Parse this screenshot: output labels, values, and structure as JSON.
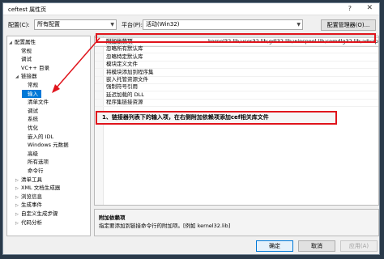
{
  "window": {
    "title": "ceftest 属性页",
    "help": "?",
    "close": "✕"
  },
  "toolbar": {
    "config_label": "配置(C):",
    "config_value": "所有配置",
    "platform_label": "平台(P):",
    "platform_value": "活动(Win32)",
    "config_manager": "配置管理器(O)..."
  },
  "tree": [
    {
      "label": "配置属性",
      "indent": 0,
      "toggle": "◢",
      "selected": false
    },
    {
      "label": "常规",
      "indent": 1,
      "toggle": "",
      "selected": false
    },
    {
      "label": "调试",
      "indent": 1,
      "toggle": "",
      "selected": false
    },
    {
      "label": "VC++ 目录",
      "indent": 1,
      "toggle": "",
      "selected": false
    },
    {
      "label": "链接器",
      "indent": 1,
      "toggle": "◢",
      "selected": false
    },
    {
      "label": "常规",
      "indent": 2,
      "toggle": "",
      "selected": false
    },
    {
      "label": "输入",
      "indent": 2,
      "toggle": "",
      "selected": true
    },
    {
      "label": "清单文件",
      "indent": 2,
      "toggle": "",
      "selected": false
    },
    {
      "label": "调试",
      "indent": 2,
      "toggle": "",
      "selected": false
    },
    {
      "label": "系统",
      "indent": 2,
      "toggle": "",
      "selected": false
    },
    {
      "label": "优化",
      "indent": 2,
      "toggle": "",
      "selected": false
    },
    {
      "label": "嵌入的 IDL",
      "indent": 2,
      "toggle": "",
      "selected": false
    },
    {
      "label": "Windows 元数据",
      "indent": 2,
      "toggle": "",
      "selected": false
    },
    {
      "label": "高级",
      "indent": 2,
      "toggle": "",
      "selected": false
    },
    {
      "label": "所有选项",
      "indent": 2,
      "toggle": "",
      "selected": false
    },
    {
      "label": "命令行",
      "indent": 2,
      "toggle": "",
      "selected": false
    },
    {
      "label": "清单工具",
      "indent": 1,
      "toggle": "▷",
      "selected": false
    },
    {
      "label": "XML 文档生成器",
      "indent": 1,
      "toggle": "▷",
      "selected": false
    },
    {
      "label": "浏览信息",
      "indent": 1,
      "toggle": "▷",
      "selected": false
    },
    {
      "label": "生成事件",
      "indent": 1,
      "toggle": "▷",
      "selected": false
    },
    {
      "label": "自定义生成步骤",
      "indent": 1,
      "toggle": "▷",
      "selected": false
    },
    {
      "label": "代码分析",
      "indent": 1,
      "toggle": "▷",
      "selected": false
    }
  ],
  "grid": [
    {
      "name": "附加依赖项",
      "value": "kernel32.lib;user32.lib;gdi32.lib;winspool.lib;comdlg32.lib;advapi3",
      "selected": true
    },
    {
      "name": "忽略所有默认库",
      "value": "",
      "selected": false
    },
    {
      "name": "忽略特定默认库",
      "value": "",
      "selected": false
    },
    {
      "name": "模块定义文件",
      "value": "",
      "selected": false
    },
    {
      "name": "将模块添加到程序集",
      "value": "",
      "selected": false
    },
    {
      "name": "嵌入托管资源文件",
      "value": "",
      "selected": false
    },
    {
      "name": "强制符号引用",
      "value": "",
      "selected": false
    },
    {
      "name": "延迟加载的 DLL",
      "value": "",
      "selected": false
    },
    {
      "name": "程序集链接资源",
      "value": "",
      "selected": false
    }
  ],
  "annotation": "1、链接器列表下的输入项，在右侧附加依赖项添加cef相关库文件",
  "description": {
    "title": "附加依赖项",
    "text": "指定要添加到链接命令行的附加项。[例如 kernel32.lib]"
  },
  "buttons": {
    "ok": "确定",
    "cancel": "取消",
    "apply": "应用(A)"
  },
  "colors": {
    "highlight": "#0078d7",
    "annotation_border": "#e0141c"
  }
}
